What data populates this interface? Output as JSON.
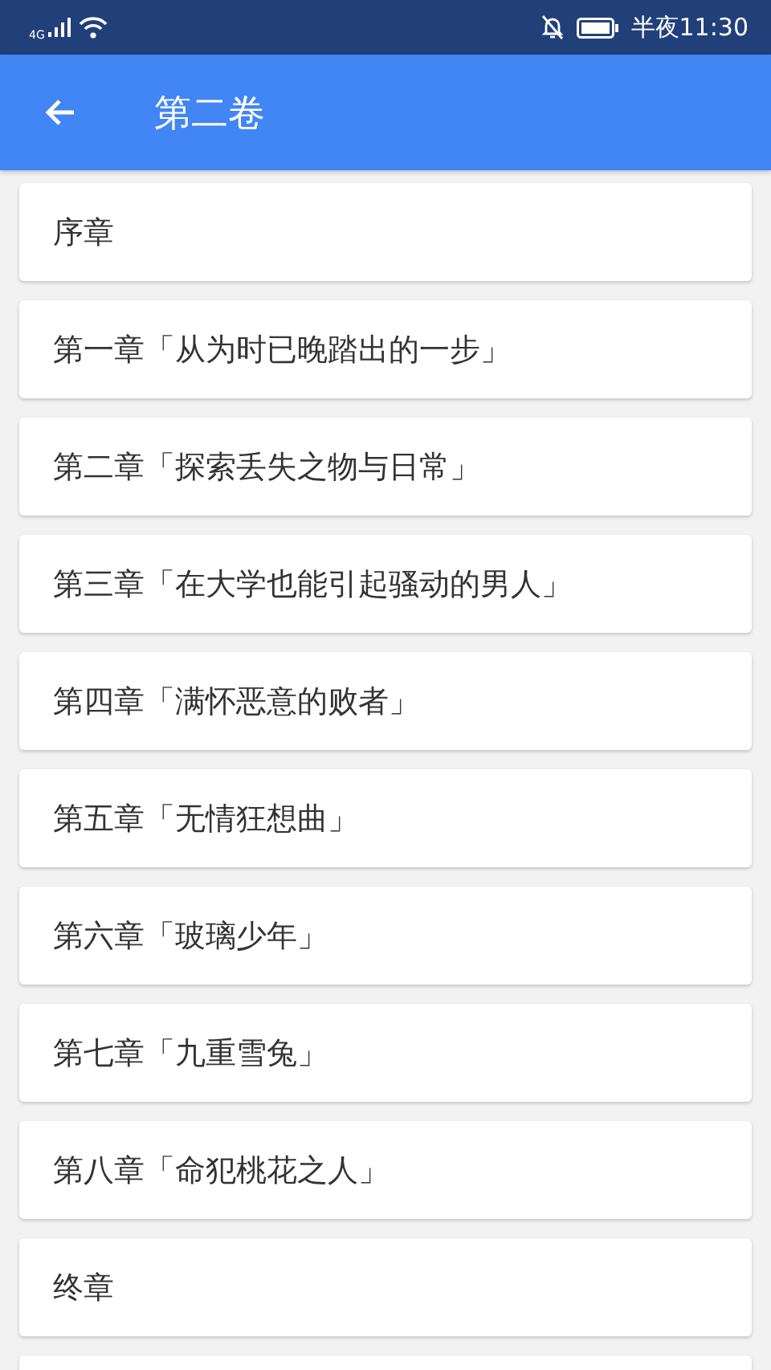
{
  "status_bar": {
    "network": "4G",
    "time": "半夜11:30"
  },
  "toolbar": {
    "title": "第二卷"
  },
  "chapters": [
    {
      "title": "序章"
    },
    {
      "title": "第一章「从为时已晚踏出的一步」"
    },
    {
      "title": "第二章「探索丢失之物与日常」"
    },
    {
      "title": "第三章「在大学也能引起骚动的男人」"
    },
    {
      "title": "第四章「满怀恶意的败者」"
    },
    {
      "title": "第五章「无情狂想曲」"
    },
    {
      "title": "第六章「玻璃少年」"
    },
    {
      "title": "第七章「九重雪兔」"
    },
    {
      "title": "第八章「命犯桃花之人」"
    },
    {
      "title": "终章"
    }
  ]
}
